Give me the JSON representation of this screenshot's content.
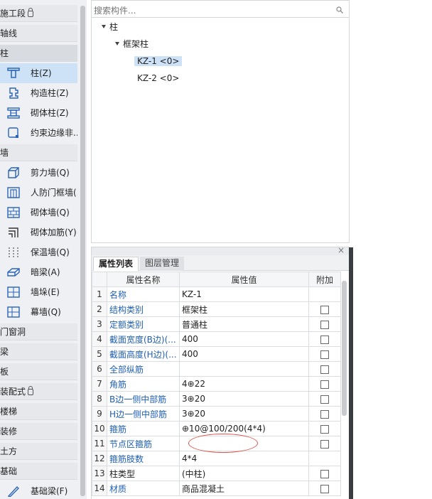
{
  "left_nav": {
    "categories": {
      "construction_stage": "施工段",
      "axis": "轴线",
      "column": "柱",
      "wall": "墙",
      "door_window": "门窗洞",
      "beam": "梁",
      "slab": "板",
      "prefab": "装配式",
      "stairs": "楼梯",
      "decoration": "装修",
      "earthwork": "土方",
      "foundation": "基础"
    },
    "column_items": [
      {
        "label": "柱(Z)",
        "icon": "column-icon"
      },
      {
        "label": "构造柱(Z)",
        "icon": "construction-column-icon"
      },
      {
        "label": "砌体柱(Z)",
        "icon": "masonry-column-icon"
      },
      {
        "label": "约束边缘非...",
        "icon": "constraint-edge-icon"
      }
    ],
    "wall_items": [
      {
        "label": "剪力墙(Q)",
        "icon": "shear-wall-icon"
      },
      {
        "label": "人防门框墙(...",
        "icon": "civil-defense-door-wall-icon"
      },
      {
        "label": "砌体墙(Q)",
        "icon": "masonry-wall-icon"
      },
      {
        "label": "砌体加筋(Y)",
        "icon": "masonry-reinforcement-icon"
      },
      {
        "label": "保温墙(Q)",
        "icon": "insulation-wall-icon"
      },
      {
        "label": "暗梁(A)",
        "icon": "hidden-beam-icon"
      },
      {
        "label": "墙垛(E)",
        "icon": "wall-pier-icon"
      },
      {
        "label": "幕墙(Q)",
        "icon": "curtain-wall-icon"
      }
    ],
    "foundation_items": [
      {
        "label": "基础梁(F)",
        "icon": "foundation-beam-icon"
      }
    ]
  },
  "tree": {
    "search_placeholder": "搜索构件...",
    "root": "柱",
    "group": "框架柱",
    "leaves": [
      "KZ-1 <0>",
      "KZ-2 <0>"
    ]
  },
  "props": {
    "tabs": {
      "active": "属性列表",
      "inactive": "图层管理"
    },
    "headers": {
      "num": "",
      "name": "属性名称",
      "value": "属性值",
      "extra": "附加"
    },
    "rows": [
      {
        "num": "1",
        "name": "名称",
        "value": "KZ-1",
        "link": true,
        "checkbox": false
      },
      {
        "num": "2",
        "name": "结构类别",
        "value": "框架柱",
        "link": true,
        "checkbox": true
      },
      {
        "num": "3",
        "name": "定额类别",
        "value": "普通柱",
        "link": true,
        "checkbox": true
      },
      {
        "num": "4",
        "name": "截面宽度(B边)(...",
        "value": "400",
        "link": true,
        "checkbox": true
      },
      {
        "num": "5",
        "name": "截面高度(H边)(...",
        "value": "400",
        "link": true,
        "checkbox": true
      },
      {
        "num": "6",
        "name": "全部纵筋",
        "value": "",
        "link": true,
        "checkbox": true
      },
      {
        "num": "7",
        "name": "角筋",
        "value": "4⊕22",
        "link": true,
        "checkbox": true
      },
      {
        "num": "8",
        "name": "B边一侧中部筋",
        "value": "3⊕20",
        "link": true,
        "checkbox": true
      },
      {
        "num": "9",
        "name": "H边一侧中部筋",
        "value": "3⊕20",
        "link": true,
        "checkbox": true
      },
      {
        "num": "10",
        "name": "箍筋",
        "value": "⊕10@100/200(4*4)",
        "link": true,
        "checkbox": true
      },
      {
        "num": "11",
        "name": "节点区箍筋",
        "value": "",
        "link": true,
        "checkbox": true
      },
      {
        "num": "12",
        "name": "箍筋肢数",
        "value": "4*4",
        "link": true,
        "checkbox": false
      },
      {
        "num": "13",
        "name": "柱类型",
        "value": "(中柱)",
        "link": false,
        "checkbox": true
      },
      {
        "num": "14",
        "name": "材质",
        "value": "商品混凝土",
        "link": true,
        "checkbox": true
      }
    ]
  },
  "colors": {
    "accent_link": "#1f5fb4",
    "selected_bg": "#cde2f7",
    "annotation_red": "#e0524c"
  }
}
